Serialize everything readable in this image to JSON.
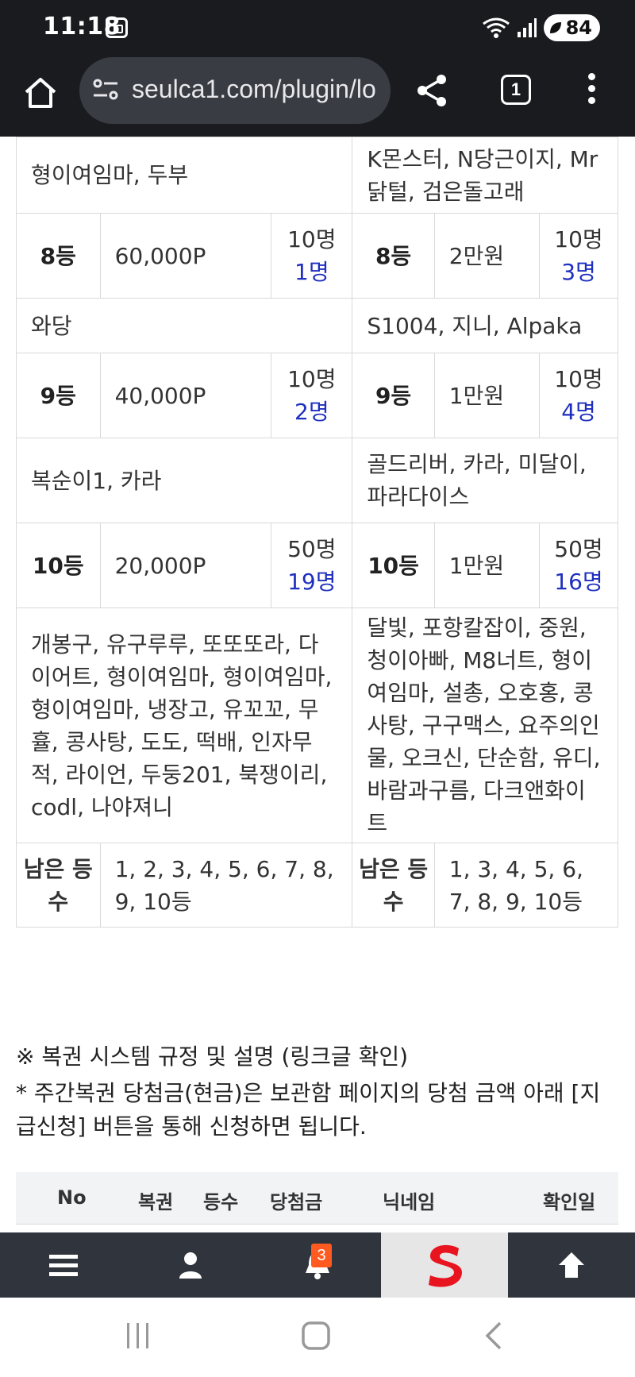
{
  "status_bar": {
    "time": "11:18",
    "wifi_label": "5",
    "battery": "84"
  },
  "browser": {
    "url": "seulca1.com/plugin/lo",
    "tab_count": "1"
  },
  "table": {
    "top_left_names": "형이여임마, 두부",
    "top_right_names": "K몬스터, N당근이지, Mr 닭털, 검은돌고래",
    "rows": [
      {
        "left": {
          "rank": "8등",
          "prize": "60,000P",
          "total": "10명",
          "won": "1명"
        },
        "right": {
          "rank": "8등",
          "prize": "2만원",
          "total": "10명",
          "won": "3명"
        },
        "left_names": "와당",
        "right_names": "S1004, 지니, Alpaka"
      },
      {
        "left": {
          "rank": "9등",
          "prize": "40,000P",
          "total": "10명",
          "won": "2명"
        },
        "right": {
          "rank": "9등",
          "prize": "1만원",
          "total": "10명",
          "won": "4명"
        },
        "left_names": "복순이1, 카라",
        "right_names": "골드리버, 카라, 미달이, 파라다이스"
      },
      {
        "left": {
          "rank": "10등",
          "prize": "20,000P",
          "total": "50명",
          "won": "19명"
        },
        "right": {
          "rank": "10등",
          "prize": "1만원",
          "total": "50명",
          "won": "16명"
        },
        "left_names": "개봉구, 유구루루, 또또또라, 다이어트, 형이여임마, 형이여임마, 형이여임마, 냉장고, 유꼬꼬, 무휼, 콩사탕, 도도, 떡배, 인자무적, 라이언, 두둥201, 북쟁이리, codl, 나야져니",
        "right_names": "달빛, 포항칼잡이, 중원, 청이아빠, M8너트, 형이여임마, 설총, 오호홍, 콩사탕, 구구맥스, 요주의인물, 오크신, 단순함, 유디, 바람과구름, 다크앤화이트"
      }
    ],
    "remaining": {
      "label": "남은 등수",
      "left": "1, 2, 3, 4, 5, 6, 7, 8, 9, 10등",
      "right": "1, 3, 4, 5, 6, 7, 8, 9, 10등"
    }
  },
  "notes": {
    "line1": "※ 복권 시스템 규정 및 설명 (링크글 확인)",
    "line2": "* 주간복권 당첨금(현금)은 보관함 페이지의 당첨 금액 아래 [지급신청] 버튼을 통해 신청하면 됩니다."
  },
  "list_header": {
    "no": "No",
    "lottery": "복권",
    "rank": "등수",
    "prize": "당첨금",
    "nickname": "닉네임",
    "date": "확인일"
  },
  "bottom_nav": {
    "notification_count": "3",
    "accent_color": "#e8141f"
  },
  "colors": {
    "winner_count": "#1f2fbf",
    "bar_bg": "#1a1b1f",
    "nav_bg": "#30353d"
  }
}
